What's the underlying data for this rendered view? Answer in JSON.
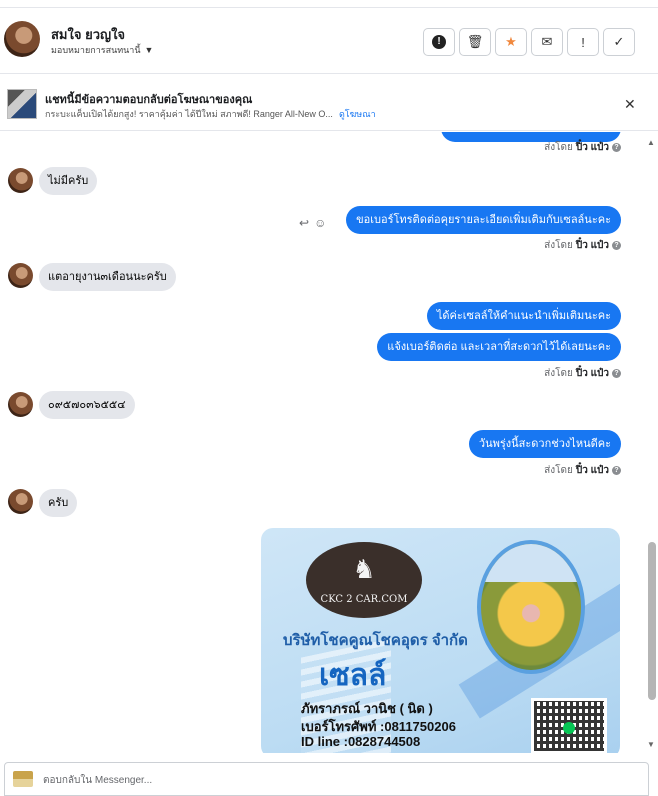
{
  "header": {
    "contact_name": "สมใจ ยวญใจ",
    "assign_label": "มอบหมายการสนทนานี้",
    "actions": [
      "!",
      "trash",
      "star",
      "mail",
      "!",
      "check"
    ]
  },
  "ad_banner": {
    "title": "แชทนี้มีข้อความตอบกลับต่อโฆษณาของคุณ",
    "subtitle": "กระบะแค็บเปิดได้ยกสูง! ราคาคุ้มค่า ได้ปีใหม่ สภาพดี! Ranger All-New O...",
    "link": "ดูโฆษณา"
  },
  "messages": {
    "sent_prefix": "ส่งโดย",
    "sender": "ปิ๋ว แป๋ว",
    "m1": "ไม่มีครับ",
    "m2": "ขอเบอร์โทรติดต่อคุยรายละเอียดเพิ่มเติมกับเซลล์นะคะ",
    "m3": "แตอายุงาน๓เดือนนะครับ",
    "m4": "ได้ค่ะเซลล์ให้คำแนะนำเพิ่มเติมนะคะ",
    "m5": "แจ้งเบอร์ติดต่อ  และเวลาที่สะดวกไว้ได้เลยนะคะ",
    "m6": "๐๙๕๗๐๓๖๕๕๔",
    "m7": "วันพรุ่งนี้สะดวกช่วงไหนดีคะ",
    "m8": "ครับ"
  },
  "card": {
    "logo_text": "CKC 2 CAR.COM",
    "company": "บริษัทโชคคูณโชคอุดร จำกัด",
    "role": "เซลล์",
    "name": "ภัทราภรณ์  วานิช ( นิด )",
    "phone": "เบอร์โทรศัพท์ :0811750206",
    "line": "ID line :0828744508"
  },
  "composer": {
    "placeholder": "ตอบกลับใน Messenger..."
  }
}
